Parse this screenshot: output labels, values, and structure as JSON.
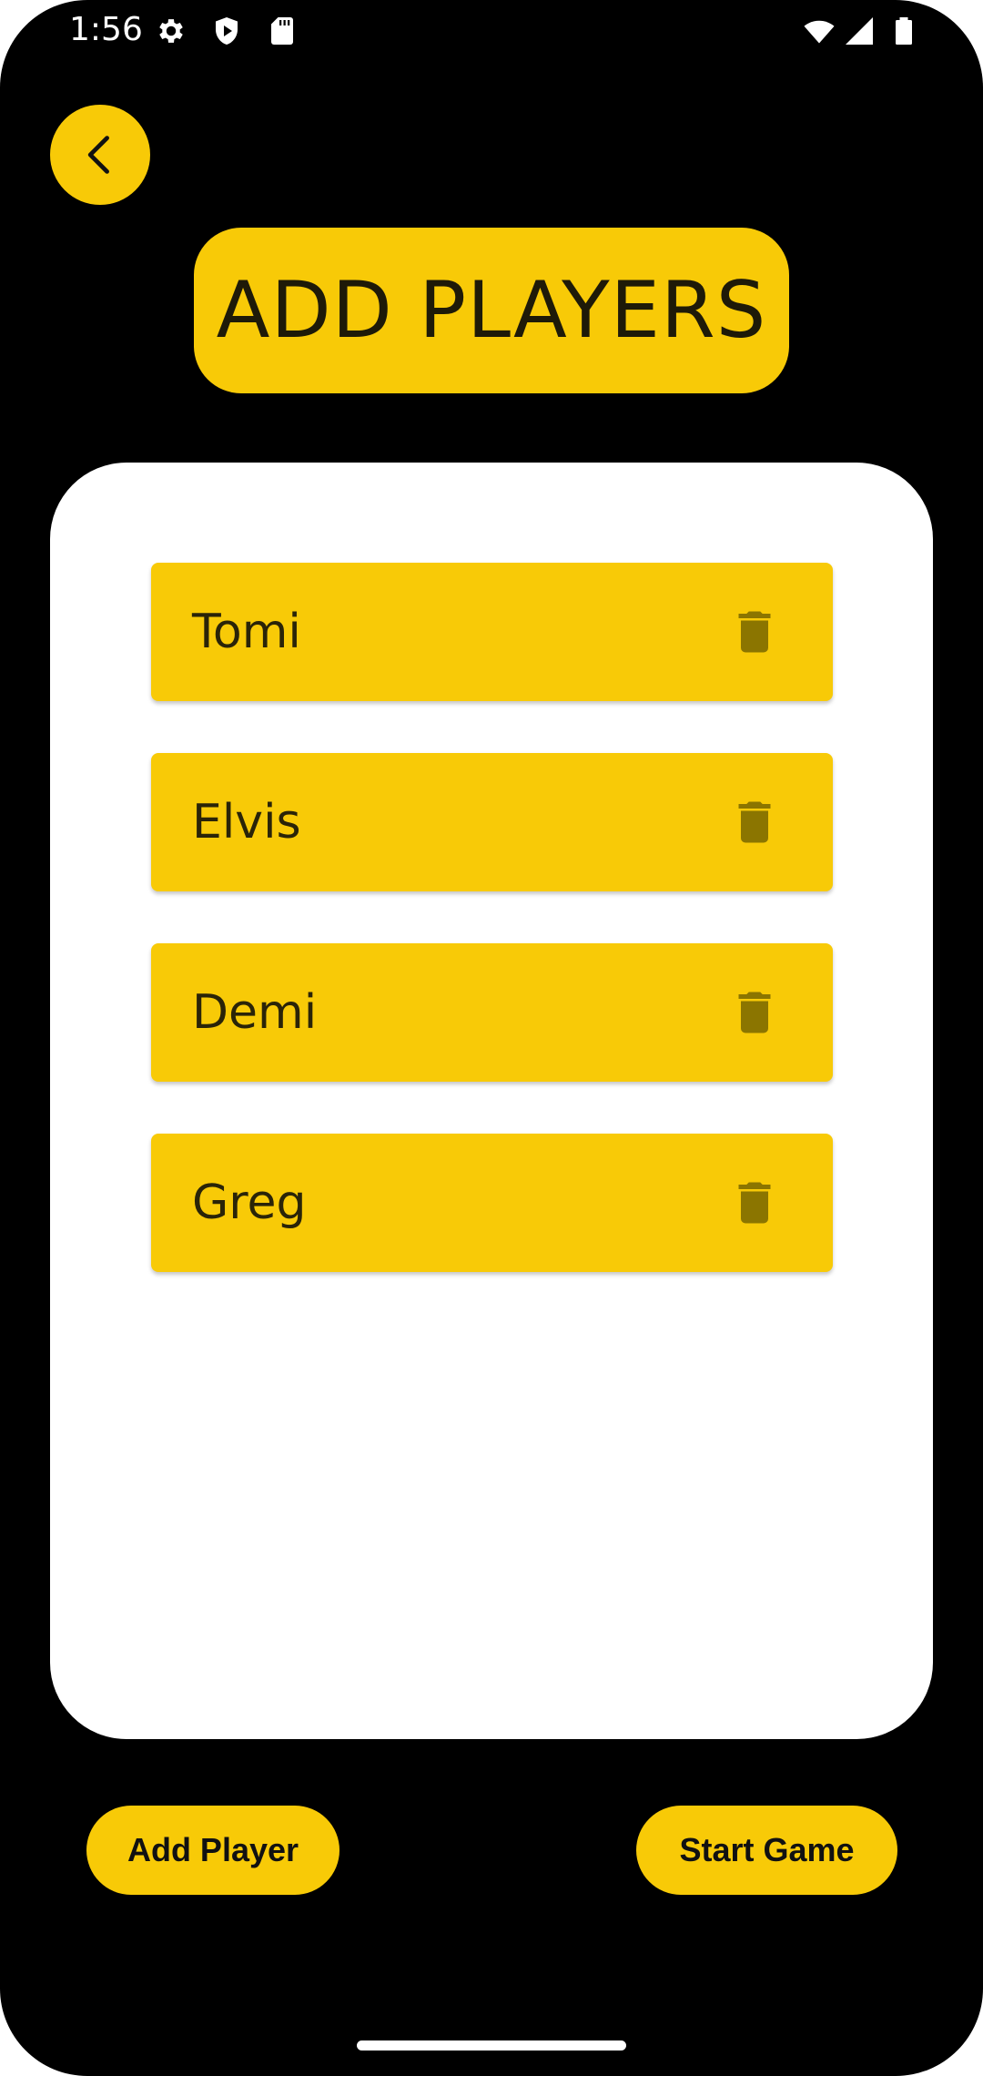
{
  "status_bar": {
    "time": "1:56",
    "left_icons": [
      "gear-icon",
      "play-protect-icon",
      "sd-card-icon"
    ],
    "right_icons": [
      "wifi-icon",
      "signal-icon",
      "battery-icon"
    ]
  },
  "header": {
    "back_icon": "chevron-left-icon",
    "title": "ADD PLAYERS"
  },
  "players": [
    {
      "name": "Tomi"
    },
    {
      "name": "Elvis"
    },
    {
      "name": "Demi"
    },
    {
      "name": "Greg"
    }
  ],
  "row_action_icon": "trash-icon",
  "actions": {
    "add_player_label": "Add Player",
    "start_game_label": "Start Game"
  },
  "colors": {
    "accent": "#f8ca07",
    "background": "#000000",
    "card": "#ffffff",
    "trash_icon": "#8b7500"
  }
}
